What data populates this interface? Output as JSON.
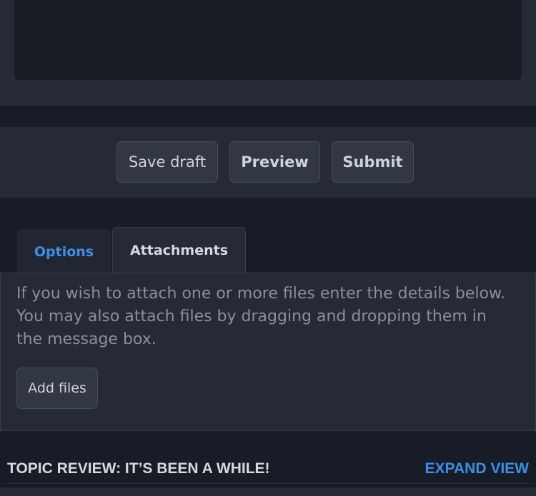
{
  "editor": {
    "message_placeholder": ""
  },
  "submit_bar": {
    "save_draft_label": "Save draft",
    "preview_label": "Preview",
    "submit_label": "Submit"
  },
  "tabs": [
    {
      "label": "Options",
      "active": false
    },
    {
      "label": "Attachments",
      "active": true
    }
  ],
  "attachments": {
    "help_text": "If you wish to attach one or more files enter the details below. You may also attach files by dragging and dropping them in the message box.",
    "add_files_label": "Add files"
  },
  "topic_review": {
    "title": "TOPIC REVIEW: IT’S BEEN A WHILE!",
    "expand_label": "EXPAND VIEW"
  },
  "colors": {
    "background": "#181c26",
    "panel": "#262a36",
    "accent": "#3c8ee6",
    "button": "#323744"
  }
}
